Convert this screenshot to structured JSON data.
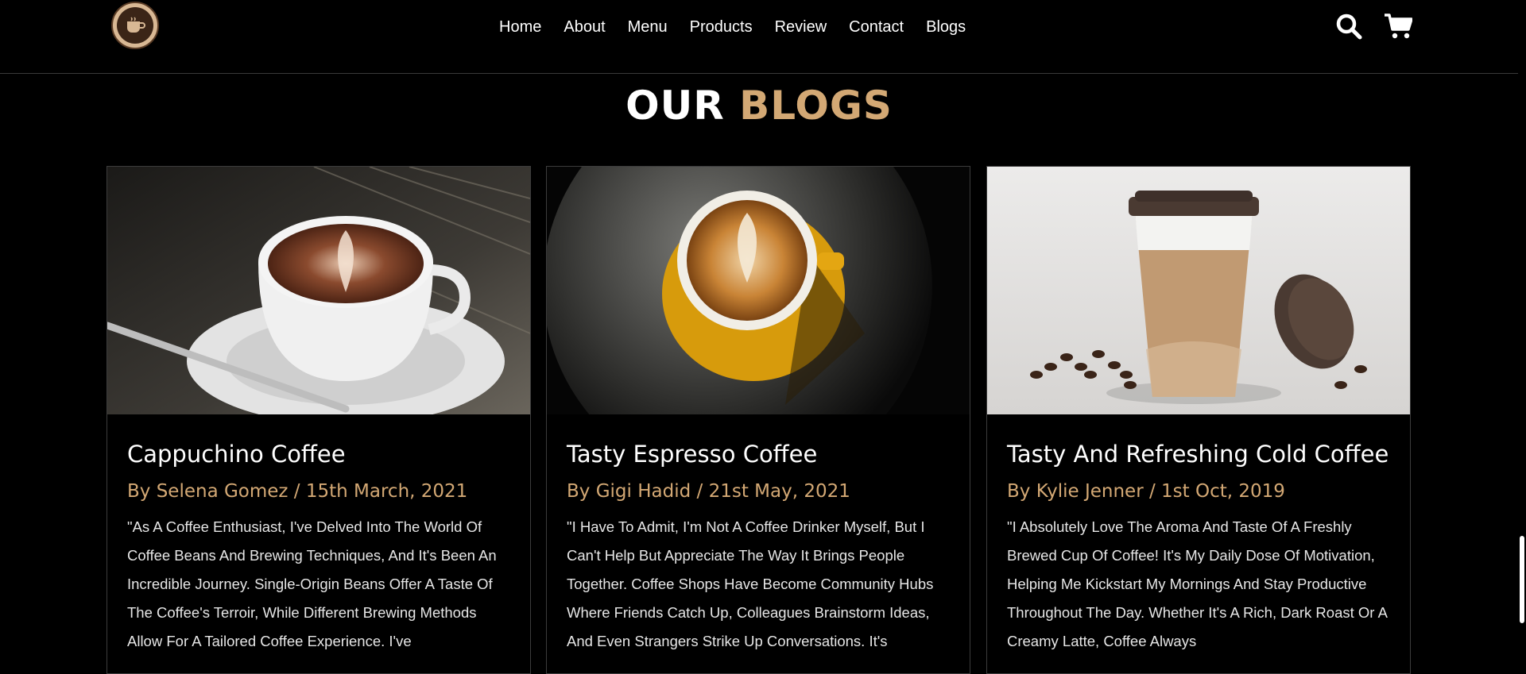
{
  "nav": {
    "items": [
      "Home",
      "About",
      "Menu",
      "Products",
      "Review",
      "Contact",
      "Blogs"
    ]
  },
  "icons": {
    "logo": "coffee-cup-logo",
    "search": "search-icon",
    "cart": "shopping-cart-icon"
  },
  "heading": {
    "part1": "OUR",
    "part2": "BLOGS"
  },
  "colors": {
    "accent": "#d3a874",
    "background": "#000000"
  },
  "blogs": [
    {
      "title": "Cappuchino Coffee",
      "meta": "By Selena Gomez / 15th March, 2021",
      "text": "\"As A Coffee Enthusiast, I've Delved Into The World Of Coffee Beans And Brewing Techniques, And It's Been An Incredible Journey. Single-Origin Beans Offer A Taste Of The Coffee's Terroir, While Different Brewing Methods Allow For A Tailored Coffee Experience. I've"
    },
    {
      "title": "Tasty Espresso Coffee",
      "meta": "By Gigi Hadid / 21st May, 2021",
      "text": "\"I Have To Admit, I'm Not A Coffee Drinker Myself, But I Can't Help But Appreciate The Way It Brings People Together. Coffee Shops Have Become Community Hubs Where Friends Catch Up, Colleagues Brainstorm Ideas, And Even Strangers Strike Up Conversations. It's"
    },
    {
      "title": "Tasty And Refreshing Cold Coffee",
      "meta": "By Kylie Jenner / 1st Oct, 2019",
      "text": "\"I Absolutely Love The Aroma And Taste Of A Freshly Brewed Cup Of Coffee! It's My Daily Dose Of Motivation, Helping Me Kickstart My Mornings And Stay Productive Throughout The Day. Whether It's A Rich, Dark Roast Or A Creamy Latte, Coffee Always"
    }
  ]
}
